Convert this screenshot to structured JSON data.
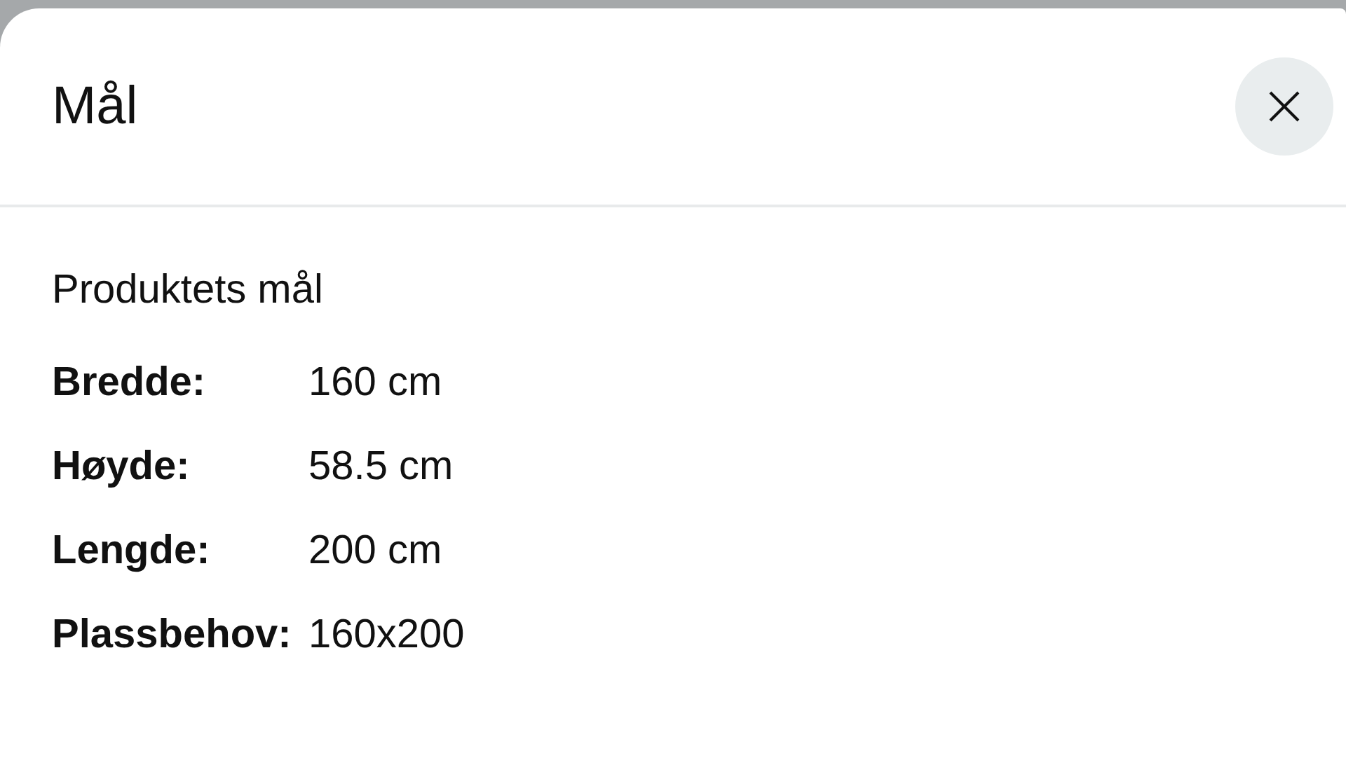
{
  "dialog": {
    "title": "Mål",
    "section_title": "Produktets mål",
    "rows": [
      {
        "label": "Bredde:",
        "value": "160 cm"
      },
      {
        "label": "Høyde:",
        "value": "58.5 cm"
      },
      {
        "label": "Lengde:",
        "value": "200 cm"
      },
      {
        "label": "Plassbehov:",
        "value": "160x200"
      }
    ]
  }
}
